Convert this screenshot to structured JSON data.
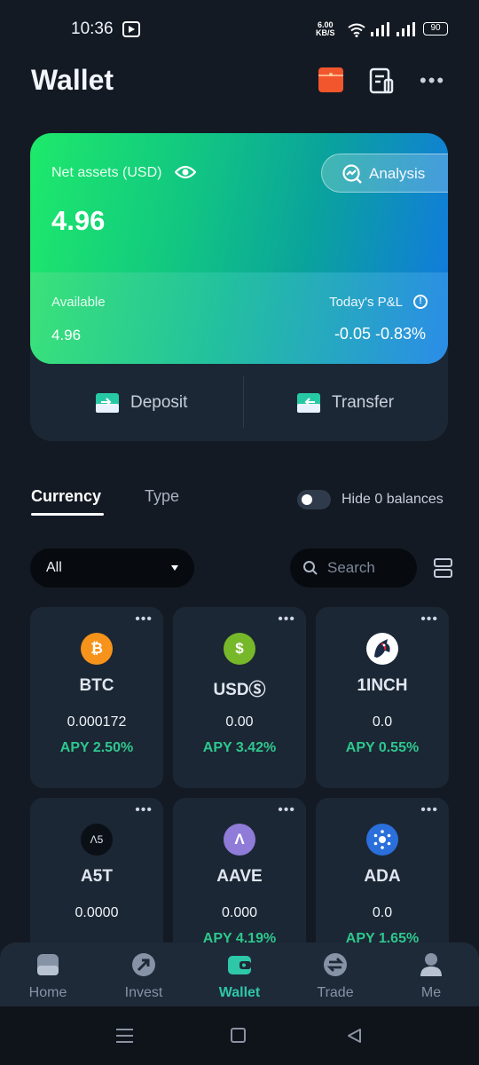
{
  "status_bar": {
    "time": "10:36",
    "net_speed_value": "6.00",
    "net_speed_unit": "KB/S",
    "battery": "90"
  },
  "header": {
    "title": "Wallet"
  },
  "asset_card": {
    "net_assets_label": "Net assets (USD)",
    "net_assets_value": "4.96",
    "analysis_label": "Analysis",
    "available_label": "Available",
    "available_value": "4.96",
    "pnl_label": "Today's P&L",
    "pnl_value": "-0.05  -0.83%",
    "deposit_label": "Deposit",
    "transfer_label": "Transfer"
  },
  "tabs": {
    "currency": "Currency",
    "type": "Type"
  },
  "hide_zero": {
    "label": "Hide 0 balances",
    "enabled": false
  },
  "filter": {
    "selected": "All",
    "search_placeholder": "Search"
  },
  "coins": [
    {
      "symbol": "BTC",
      "amount": "0.000172",
      "apy": "APY 2.50%",
      "logo_text": "₿",
      "logo_color": "#f7931a"
    },
    {
      "symbol": "USDⓈ",
      "amount": "0.00",
      "apy": "APY 3.42%",
      "logo_text": "$",
      "logo_color": "#76b82a"
    },
    {
      "symbol": "1INCH",
      "amount": "0.0",
      "apy": "APY 0.55%",
      "logo_text": "",
      "logo_color": "#ffffff"
    },
    {
      "symbol": "A5T",
      "amount": "0.0000",
      "apy": "",
      "logo_text": "Λ5",
      "logo_color": "#0b0f16"
    },
    {
      "symbol": "AAVE",
      "amount": "0.000",
      "apy": "APY 4.19%",
      "logo_text": "Λ",
      "logo_color": "#8f7bd8"
    },
    {
      "symbol": "ADA",
      "amount": "0.0",
      "apy": "APY 1.65%",
      "logo_text": "",
      "logo_color": "#2a6fdb"
    }
  ],
  "nav": {
    "items": [
      {
        "label": "Home",
        "icon": "home-icon"
      },
      {
        "label": "Invest",
        "icon": "invest-icon"
      },
      {
        "label": "Wallet",
        "icon": "wallet-icon",
        "active": true
      },
      {
        "label": "Trade",
        "icon": "trade-icon"
      },
      {
        "label": "Me",
        "icon": "profile-icon"
      }
    ]
  },
  "colors": {
    "accent": "#2ec7a8",
    "apy_green": "#2ec78d",
    "background": "#141a24",
    "card": "#1c2735"
  }
}
